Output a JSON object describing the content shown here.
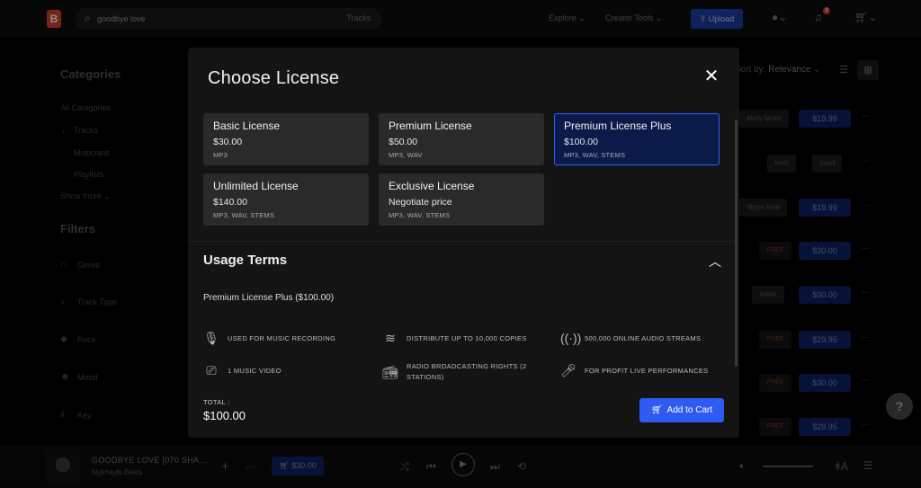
{
  "topbar": {
    "logo": "B",
    "search_value": "goodbye love",
    "search_scope": "Tracks",
    "nav": [
      "Explore ⌄",
      "Creator Tools ⌄"
    ],
    "upload_label": "Upload",
    "notification_count": "9"
  },
  "sidebar": {
    "categories_heading": "Categories",
    "categories": [
      "All Categories",
      "Tracks",
      "Musicians",
      "Playlists"
    ],
    "show_more": "Show more ⌄",
    "filters_heading": "Filters",
    "filters": [
      "Genre",
      "Track Type",
      "Price",
      "Mood",
      "Key"
    ]
  },
  "results": {
    "sort_label": "Sort by:",
    "sort_value": "Relevance",
    "tags": [
      "#tory lanez",
      "#rnb",
      "#sad",
      "#type beat",
      "#dark"
    ],
    "prices": [
      "$19.99",
      "$19.99",
      "$30.00",
      "$30.00",
      "$29.95",
      "$30.00",
      "$29.95"
    ],
    "free_label": "FREE"
  },
  "modal": {
    "title": "Choose License",
    "licenses": [
      {
        "name": "Basic License",
        "price": "$30.00",
        "formats": "MP3"
      },
      {
        "name": "Premium License",
        "price": "$50.00",
        "formats": "MP3, WAV"
      },
      {
        "name": "Premium License Plus",
        "price": "$100.00",
        "formats": "MP3, WAV, STEMS"
      },
      {
        "name": "Unlimited License",
        "price": "$140.00",
        "formats": "MP3, WAV, STEMS"
      },
      {
        "name": "Exclusive License",
        "price": "Negotiate price",
        "formats": "MP3, WAV, STEMS"
      }
    ],
    "selected_index": 2,
    "usage_heading": "Usage Terms",
    "usage_selected": "Premium License Plus ($100.00)",
    "terms": [
      {
        "icon": "microphone-icon",
        "text": "USED FOR MUSIC RECORDING"
      },
      {
        "icon": "layers-icon",
        "text": "DISTRIBUTE UP TO 10,000 COPIES"
      },
      {
        "icon": "broadcast-icon",
        "text": "500,000 ONLINE AUDIO STREAMS"
      },
      {
        "icon": "video-camera-icon",
        "text": "1 MUSIC VIDEO"
      },
      {
        "icon": "radio-icon",
        "text": "RADIO BROADCASTING RIGHTS (2 STATIONS)"
      },
      {
        "icon": "live-mic-icon",
        "text": "FOR PROFIT LIVE PERFORMANCES"
      }
    ],
    "total_label": "TOTAL :",
    "total_value": "$100.00",
    "add_to_cart": "Add to Cart"
  },
  "player": {
    "title": "GOODBYE LOVE [070 SHA...",
    "artist": "Mykhaylo Beats",
    "price": "$30.00"
  },
  "help_label": "?"
}
